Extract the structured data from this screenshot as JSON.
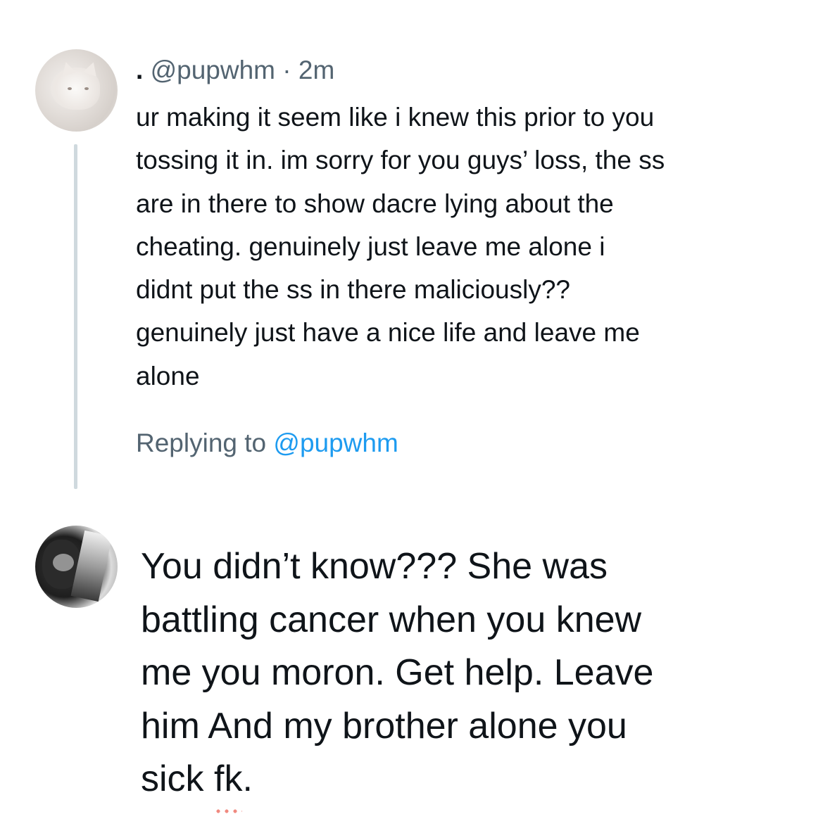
{
  "parent_tweet": {
    "display_name": ".",
    "handle": "@pupwhm",
    "separator": "·",
    "timestamp": "2m",
    "text_lines": [
      "ur making it seem like i knew this prior to you",
      "tossing it in. im sorry for you guys’ loss, the ss",
      "are in there to show dacre lying about the",
      "cheating. genuinely just leave me alone i",
      "didnt put the ss in there maliciously??",
      "genuinely just have a nice life and leave me",
      "alone"
    ]
  },
  "replying_to": {
    "prefix": "Replying to",
    "mention": "@pupwhm"
  },
  "reply_draft": {
    "text_lines": [
      "You didn’t know??? She was",
      "battling cancer when you knew",
      "me you moron. Get help. Leave",
      "him And my brother alone you"
    ],
    "last_line_prefix": "sick ",
    "last_line_flagged_word": "fk",
    "last_line_suffix": "."
  },
  "colors": {
    "text_primary": "#0f1419",
    "text_secondary": "#536471",
    "link": "#1d9bf0",
    "thread_line": "#cfd9de",
    "spellcheck": "#f08a80"
  }
}
